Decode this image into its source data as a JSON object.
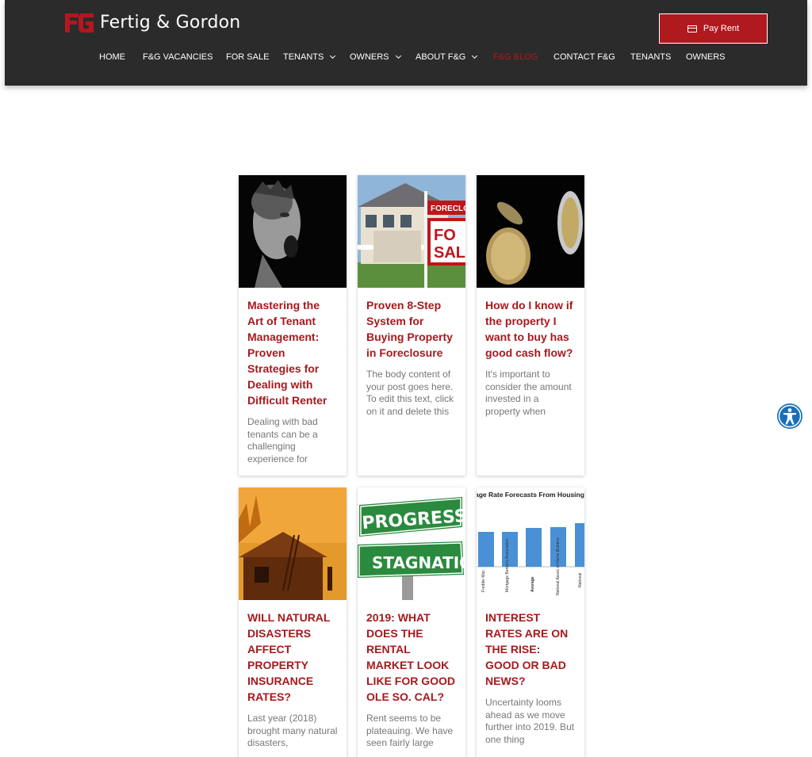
{
  "brand": {
    "name": "Fertig & Gordon",
    "accent": "#b0191e",
    "header_bg": "#2b2b2b"
  },
  "header": {
    "pay_label": "Pay Rent",
    "pay_icon": "credit-card-icon"
  },
  "nav": [
    {
      "label": "HOME",
      "dropdown": false,
      "active": false
    },
    {
      "label": "F&G VACANCIES",
      "dropdown": false,
      "active": false
    },
    {
      "label": "FOR SALE",
      "dropdown": false,
      "active": false
    },
    {
      "label": "TENANTS",
      "dropdown": true,
      "active": false
    },
    {
      "label": "OWNERS",
      "dropdown": true,
      "active": false
    },
    {
      "label": "ABOUT F&G",
      "dropdown": true,
      "active": false
    },
    {
      "label": "F&G BLOG",
      "dropdown": false,
      "active": true
    },
    {
      "label": "CONTACT F&G",
      "dropdown": false,
      "active": false
    },
    {
      "label": "TENANTS",
      "dropdown": false,
      "active": false
    },
    {
      "label": "OWNERS",
      "dropdown": false,
      "active": false
    }
  ],
  "posts": [
    {
      "title": "Mastering the Art of Tenant Management: Proven Strategies for Dealing with Difficult Renter",
      "excerpt": "Dealing with bad tenants can be a challenging experience for"
    },
    {
      "title": "Proven 8-Step System for Buying Property in Foreclosure",
      "excerpt": "The body content of your post goes here. To edit this text, click on it and delete this",
      "image_sign": {
        "top": "FORECLO",
        "big": "FO SAL"
      }
    },
    {
      "title": "How do I know if the property I want to buy has good cash flow?",
      "excerpt": "It's important to consider the amount invested in a property when"
    },
    {
      "title": "WILL NATURAL DISASTERS AFFECT PROPERTY INSURANCE RATES?",
      "excerpt": "Last year (2018) brought many natural disasters,"
    },
    {
      "title": "2019: WHAT DOES THE RENTAL MARKET LOOK LIKE FOR GOOD OLE SO. CAL?",
      "excerpt": "Rent seems to be plateauing. We have seen fairly large",
      "image_signs": [
        "PROGRESS",
        "STAGNATION"
      ]
    },
    {
      "title": "INTEREST RATES ARE ON THE RISE: GOOD OR BAD NEWS?",
      "excerpt": "Uncertainty looms ahead as we move further into 2019. But one thing",
      "image_chart": {
        "title": "age Rate Forecasts From Housing",
        "labels": [
          "Freddie Mac",
          "Mortgage Bankers Association",
          "Average",
          "National Assoc of Home Builders",
          "National"
        ]
      }
    }
  ],
  "accessibility": {
    "icon": "accessibility-icon",
    "color": "#1a6fb8"
  }
}
